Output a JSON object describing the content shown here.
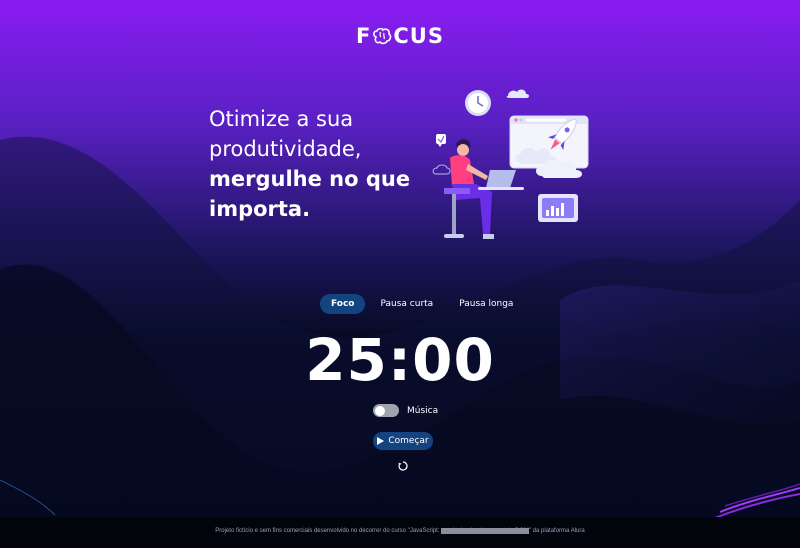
{
  "header": {
    "logo_left": "F",
    "logo_right": "CUS",
    "logo_icon": "brain-icon"
  },
  "hero": {
    "line1": "Otimize a sua",
    "line2": "produtividade,",
    "line3": "mergulhe no que",
    "line4": "importa."
  },
  "tabs": [
    {
      "label": "Foco",
      "active": true
    },
    {
      "label": "Pausa curta",
      "active": false
    },
    {
      "label": "Pausa longa",
      "active": false
    }
  ],
  "timer": {
    "value": "25:00"
  },
  "music": {
    "label": "Música",
    "enabled": false
  },
  "start_button": {
    "label": "Começar",
    "icon": "play-icon"
  },
  "reset_icon": "reset-icon",
  "footer": {
    "text_before": "Projeto fictício e sem fins comerciais desenvolvido no decorrer do curso \"JavaScript: ",
    "text_highlight": "manipulando elementos do DOM",
    "text_after": "\" da plataforma Alura"
  },
  "colors": {
    "accent": "#144480",
    "top_gradient": "#8a1cf2",
    "background": "#02050f"
  }
}
